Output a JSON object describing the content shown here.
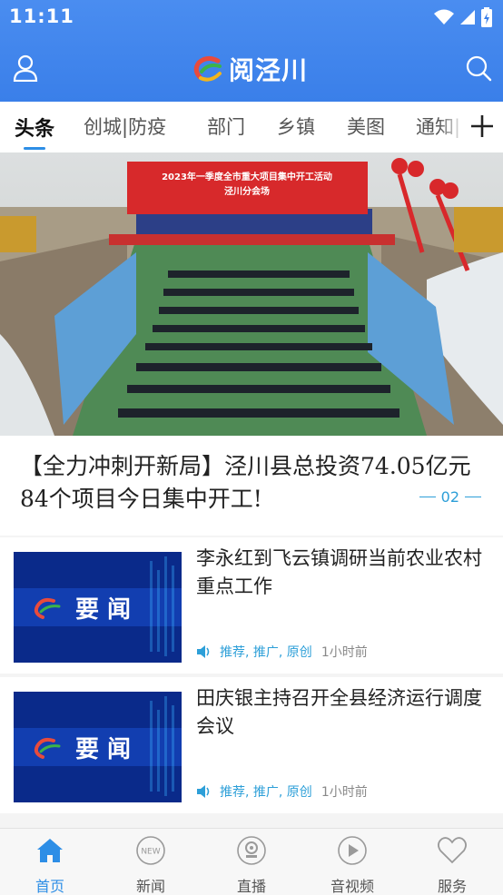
{
  "status_bar": {
    "time": "11:11"
  },
  "header": {
    "app_name": "阅泾川",
    "brand_colors": {
      "bar": "#3a7fe9",
      "accent": "#2d8ee6"
    }
  },
  "tabs": [
    {
      "label": "头条",
      "active": true
    },
    {
      "label": "创城|防疫"
    },
    {
      "label": "部门"
    },
    {
      "label": "乡镇"
    },
    {
      "label": "美图"
    },
    {
      "label": "通知|"
    }
  ],
  "banner": {
    "sign_line1": "2023年一季度全市重大项目集中开工活动",
    "sign_line2": "泾川分会场",
    "title": "【全力冲刺开新局】泾川县总投资74.05亿元84个项目今日集中开工!",
    "page": "02"
  },
  "news": [
    {
      "headline": "李永红到飞云镇调研当前农业农村重点工作",
      "thumb_text": "要 闻",
      "tags": "推荐, 推广, 原创",
      "time": "1小时前"
    },
    {
      "headline": "田庆银主持召开全县经济运行调度会议",
      "thumb_text": "要 闻",
      "tags": "推荐, 推广, 原创",
      "time": "1小时前"
    }
  ],
  "bottom_nav": [
    {
      "label": "首页",
      "icon": "home-icon",
      "active": true
    },
    {
      "label": "新闻",
      "icon": "new-badge-icon",
      "badge": "NEW"
    },
    {
      "label": "直播",
      "icon": "live-icon"
    },
    {
      "label": "音视频",
      "icon": "play-icon"
    },
    {
      "label": "服务",
      "icon": "heart-icon"
    }
  ]
}
